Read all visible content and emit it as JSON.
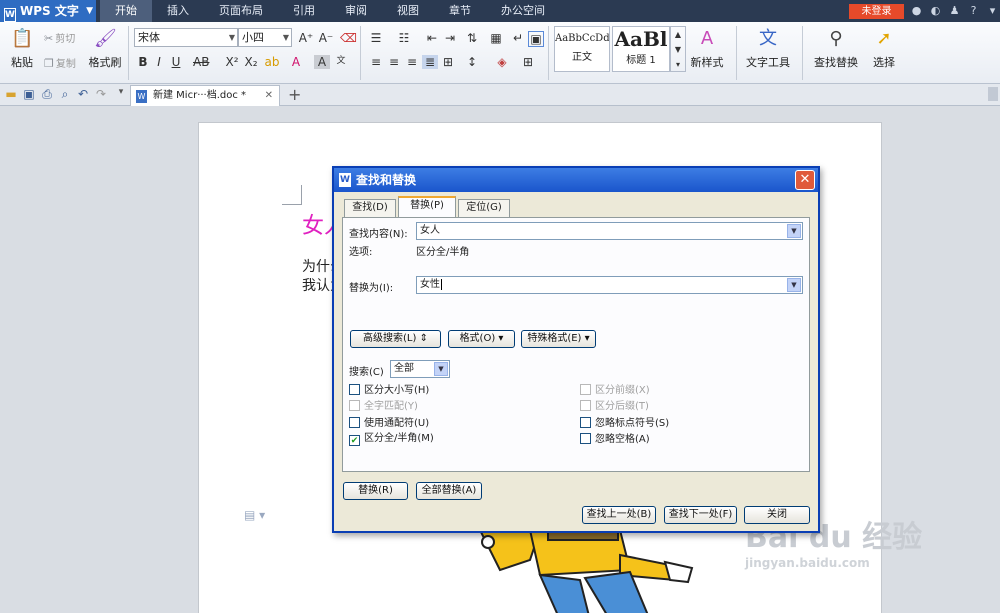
{
  "app": {
    "name": "WPS 文字"
  },
  "menu": {
    "tabs": [
      "开始",
      "插入",
      "页面布局",
      "引用",
      "审阅",
      "视图",
      "章节",
      "办公空间"
    ],
    "login": "未登录",
    "help": "?"
  },
  "ribbon": {
    "paste": "粘贴",
    "cut": "剪切",
    "copy": "复制",
    "format_painter": "格式刷",
    "font_name": "宋体",
    "font_size": "小四",
    "bold": "B",
    "italic": "I",
    "underline": "U",
    "style_normal_sample": "AaBbCcDd",
    "style_normal": "正文",
    "style_heading_sample": "AaBl",
    "style_heading": "标题 1",
    "new_style": "新样式",
    "text_tools": "文字工具",
    "find_replace": "查找替换",
    "select": "选择"
  },
  "doctab": {
    "name": "新建 Micr···档.doc *"
  },
  "document": {
    "title_partial": "女人",
    "line1_partial": "为什么",
    "line2_partial": "我认为"
  },
  "watermark": {
    "main": "Bai du 经验",
    "sub": "jingyan.baidu.com"
  },
  "dialog": {
    "title": "查找和替换",
    "tabs": [
      "查找(D)",
      "替换(P)",
      "定位(G)"
    ],
    "find_label": "查找内容(N):",
    "find_value": "女人",
    "options_label": "选项:",
    "options_value": "区分全/半角",
    "replace_label": "替换为(I):",
    "replace_value": "女性",
    "advanced_btn": "高级搜索(L) ⇕",
    "format_btn": "格式(O) ▾",
    "special_btn": "特殊格式(E) ▾",
    "search_label": "搜索(C)",
    "search_value": "全部",
    "checkboxes_left": [
      {
        "label": "区分大小写(H)",
        "checked": false,
        "disabled": false
      },
      {
        "label": "全字匹配(Y)",
        "checked": false,
        "disabled": true
      },
      {
        "label": "使用通配符(U)",
        "checked": false,
        "disabled": false
      },
      {
        "label": "区分全/半角(M)",
        "checked": true,
        "disabled": false
      }
    ],
    "checkboxes_right": [
      {
        "label": "区分前缀(X)",
        "checked": false,
        "disabled": true
      },
      {
        "label": "区分后缀(T)",
        "checked": false,
        "disabled": true
      },
      {
        "label": "忽略标点符号(S)",
        "checked": false,
        "disabled": false
      },
      {
        "label": "忽略空格(A)",
        "checked": false,
        "disabled": false
      }
    ],
    "replace_btn": "替换(R)",
    "replace_all_btn": "全部替换(A)",
    "find_prev_btn": "查找上一处(B)",
    "find_next_btn": "查找下一处(F)",
    "close_btn": "关闭"
  }
}
